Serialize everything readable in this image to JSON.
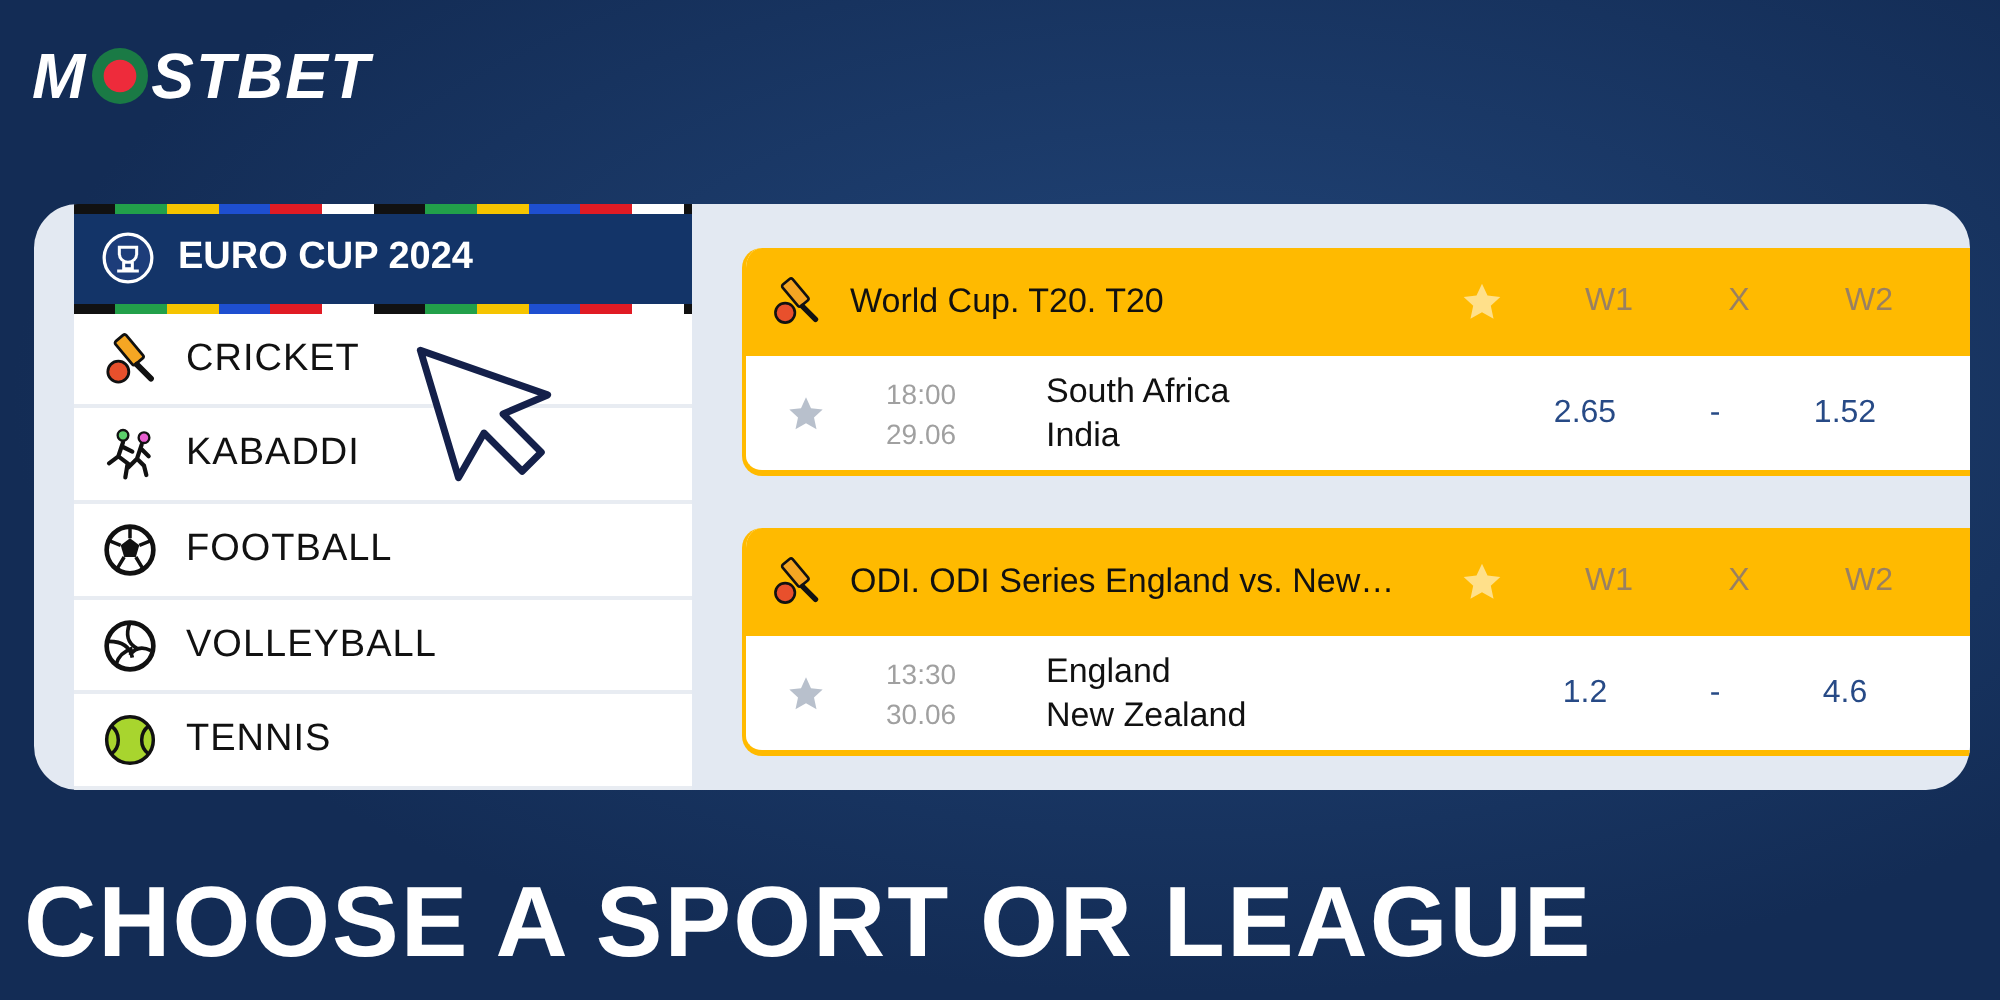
{
  "logo": {
    "before": "M",
    "after": "STBET"
  },
  "banner": {
    "title": "EURO CUP 2024"
  },
  "sports": [
    {
      "label": "CRICKET"
    },
    {
      "label": "KABADDI"
    },
    {
      "label": "FOOTBALL"
    },
    {
      "label": "VOLLEYBALL"
    },
    {
      "label": "TENNIS"
    }
  ],
  "leagues": [
    {
      "title": "World Cup. T20. T20",
      "columns": [
        "W1",
        "X",
        "W2"
      ],
      "matches": [
        {
          "time": "18:00",
          "date": "29.06",
          "team_1": "South Africa",
          "team_2": "India",
          "odds": [
            "2.65",
            "-",
            "1.52"
          ]
        }
      ]
    },
    {
      "title": "ODI. ODI Series England vs. New…",
      "columns": [
        "W1",
        "X",
        "W2"
      ],
      "matches": [
        {
          "time": "13:30",
          "date": "30.06",
          "team_1": "England",
          "team_2": "New Zealand",
          "odds": [
            "1.2",
            "-",
            "4.6"
          ]
        }
      ]
    }
  ],
  "headline": "CHOOSE A SPORT OR LEAGUE"
}
